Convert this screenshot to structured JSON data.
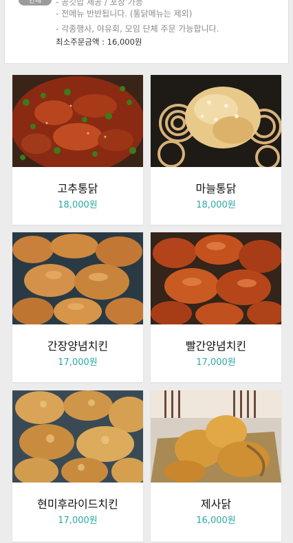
{
  "info": {
    "badge": "안내",
    "line0": "- 공깃밥 제공 / 포장 가능",
    "line1": "- 전메뉴 반반됩니다. (통닭메뉴는 제외)",
    "line2": "- 각종행사, 야유회, 모임 단체 주문 가능합니다.",
    "min_order": "최소주문금액 : 16,000원"
  },
  "menu": [
    {
      "name": "고추통닭",
      "price": "18,000원",
      "photo": "spicy-pepper-chicken-photo"
    },
    {
      "name": "마늘통닭",
      "price": "18,000원",
      "photo": "garlic-chicken-photo"
    },
    {
      "name": "간장양념치킨",
      "price": "17,000원",
      "photo": "soy-sauce-chicken-photo"
    },
    {
      "name": "빨간양념치킨",
      "price": "17,000원",
      "photo": "red-sauce-chicken-photo"
    },
    {
      "name": "현미후라이드치킨",
      "price": "17,000원",
      "photo": "brown-rice-fried-chicken-photo"
    },
    {
      "name": "제사닭",
      "price": "16,000원",
      "photo": "ceremonial-chicken-photo"
    }
  ],
  "colors": {
    "price": "#2aa9a3",
    "background": "#ececec",
    "badge": "#9b9b9b"
  }
}
